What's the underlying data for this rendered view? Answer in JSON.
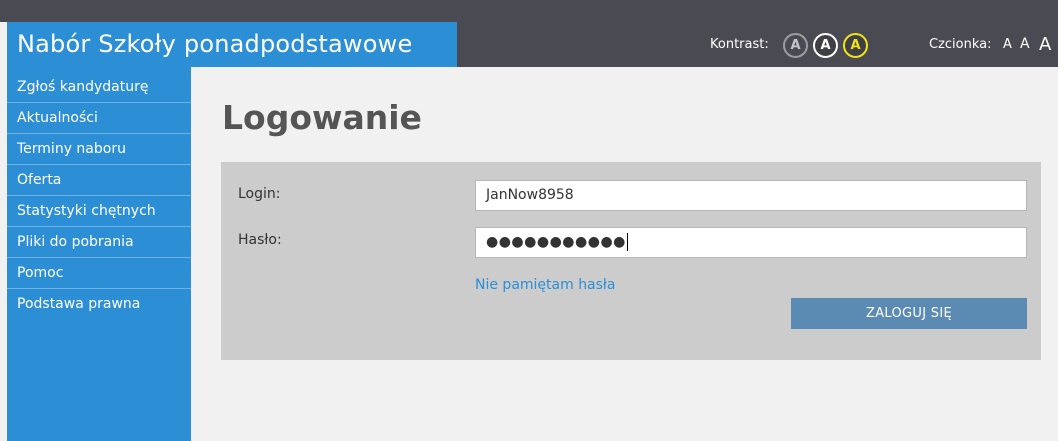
{
  "app": {
    "title": "Nabór Szkoły ponadpodstawowe"
  },
  "header": {
    "kontrast_label": "Kontrast:",
    "contrast_buttons": [
      "A",
      "A",
      "A"
    ],
    "czcionka_label": "Czcionka:",
    "font_buttons": [
      "A",
      "A",
      "A"
    ]
  },
  "sidebar": {
    "items": [
      {
        "label": "Zgłoś kandydaturę"
      },
      {
        "label": "Aktualności"
      },
      {
        "label": "Terminy naboru"
      },
      {
        "label": "Oferta"
      },
      {
        "label": "Statystyki chętnych"
      },
      {
        "label": "Pliki do pobrania"
      },
      {
        "label": "Pomoc"
      },
      {
        "label": "Podstawa prawna"
      }
    ]
  },
  "main": {
    "page_title": "Logowanie",
    "login_label": "Login:",
    "login_value": "JanNow8958",
    "password_label": "Hasło:",
    "password_masked": "●●●●●●●●●●●",
    "forgot_link": "Nie pamiętam hasła",
    "submit_label": "ZALOGUJ SIĘ"
  },
  "colors": {
    "sidebar": "#2c8fd6",
    "header": "#4a4a52",
    "panel": "#cccccc",
    "button": "#5b8bb2",
    "link": "#2c8fd6",
    "contrast_yellow": "#f2e21a"
  }
}
